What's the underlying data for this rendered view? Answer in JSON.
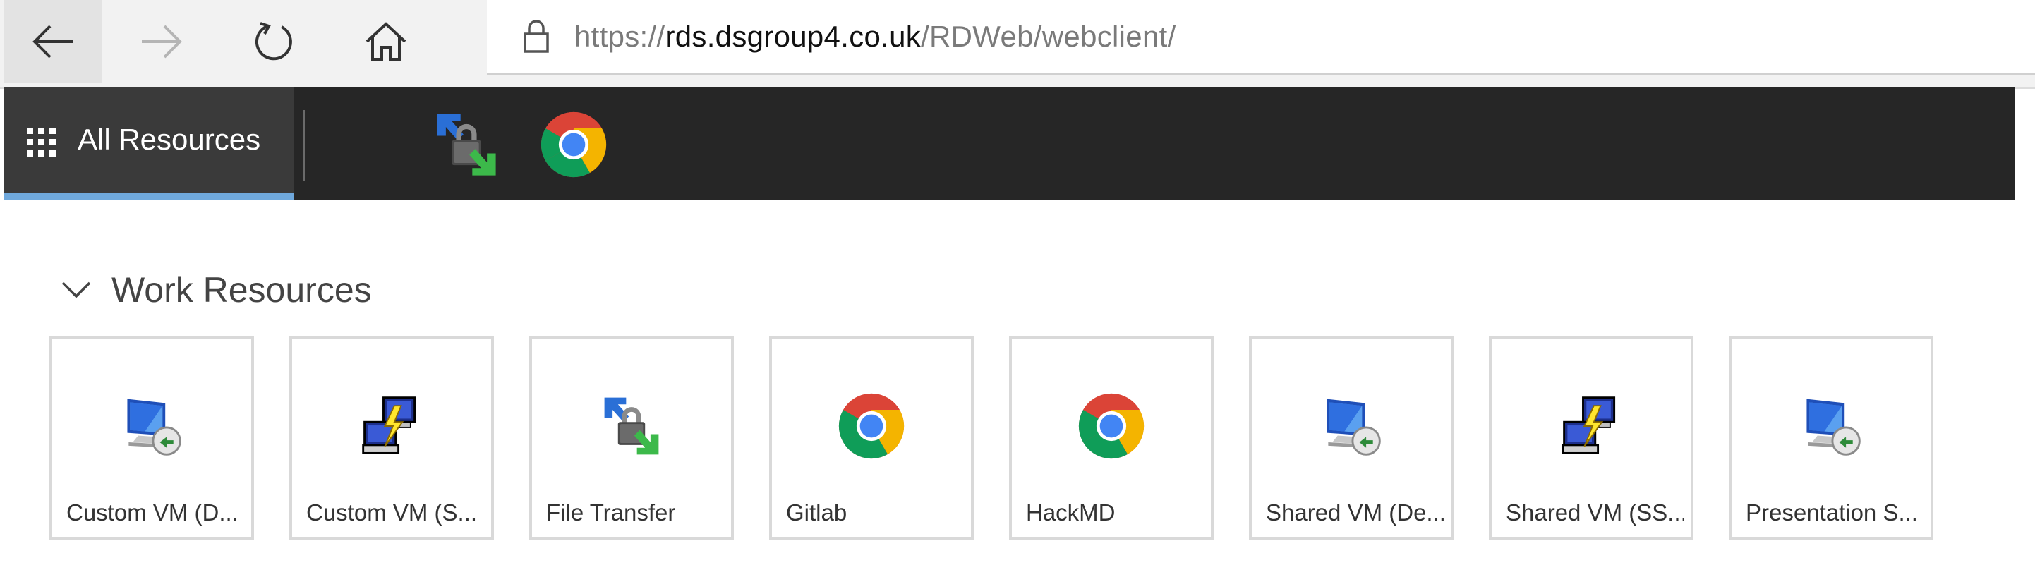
{
  "browser": {
    "url_scheme": "https://",
    "url_host": "rds.dsgroup4.co.uk",
    "url_path": "/RDWeb/webclient/",
    "icons": [
      "back-arrow-icon",
      "forward-arrow-icon",
      "refresh-icon",
      "home-icon",
      "lock-icon"
    ]
  },
  "app_bar": {
    "all_resources_label": "All Resources",
    "pinned": [
      {
        "icon": "file-transfer-icon"
      },
      {
        "icon": "chrome-icon"
      }
    ]
  },
  "section": {
    "title": "Work Resources",
    "tiles": [
      {
        "label": "Custom VM (D...",
        "icon": "remote-desktop-icon"
      },
      {
        "label": "Custom VM (S...",
        "icon": "ssh-terminal-icon"
      },
      {
        "label": "File Transfer",
        "icon": "file-transfer-icon"
      },
      {
        "label": "Gitlab",
        "icon": "chrome-icon"
      },
      {
        "label": "HackMD",
        "icon": "chrome-icon"
      },
      {
        "label": "Shared VM (De...",
        "icon": "remote-desktop-icon"
      },
      {
        "label": "Shared VM (SS...",
        "icon": "ssh-terminal-icon"
      },
      {
        "label": "Presentation S...",
        "icon": "remote-desktop-icon"
      }
    ]
  },
  "colors": {
    "app_bar": "#262626",
    "selected_tab": "#3a3a3a",
    "accent": "#6fa8dc",
    "tile_border": "#d9d9d9"
  }
}
